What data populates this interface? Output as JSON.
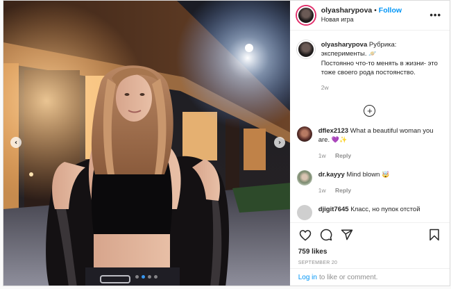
{
  "post": {
    "media": {
      "alt_description": "",
      "slide_count": 4,
      "active_slide": 2
    },
    "header": {
      "username": "olyasharypova",
      "separator": "•",
      "follow_label": "Follow",
      "location": "Новая игра",
      "more_label": "•••"
    },
    "caption": {
      "username": "olyasharypova",
      "text_line1": "Рубрика: эксперименты.",
      "emoji": "🪐",
      "text_body": "Постоянно что-то менять в жизни- это тоже своего рода постоянство.",
      "age": "2w"
    },
    "load_more_label": "+",
    "comments": [
      {
        "username": "dflex2123",
        "text": "What a beautiful woman you are.",
        "emoji": "💜✨",
        "age": "1w",
        "reply_label": "Reply"
      },
      {
        "username": "dr.kayyy",
        "text": "Mind blown",
        "emoji": "🤯",
        "age": "1w",
        "reply_label": "Reply"
      },
      {
        "username": "djigit7645",
        "text": "Класс, но пупок отстой",
        "emoji": "",
        "age": "",
        "reply_label": ""
      }
    ],
    "likes": "759 likes",
    "date": "SEPTEMBER 20",
    "login": {
      "link_label": "Log in",
      "suffix": "to like or comment."
    }
  },
  "colors": {
    "accent": "#0095f6",
    "text": "#262626",
    "muted": "#8e8e8e",
    "border": "#dbdbdb",
    "active_dot": "#3897f0"
  },
  "icons": {
    "prev": "chevron-left-icon",
    "next": "chevron-right-icon",
    "like": "heart-icon",
    "comment": "comment-icon",
    "share": "share-icon",
    "save": "bookmark-icon",
    "more": "more-icon",
    "load_more": "plus-circle-icon"
  }
}
